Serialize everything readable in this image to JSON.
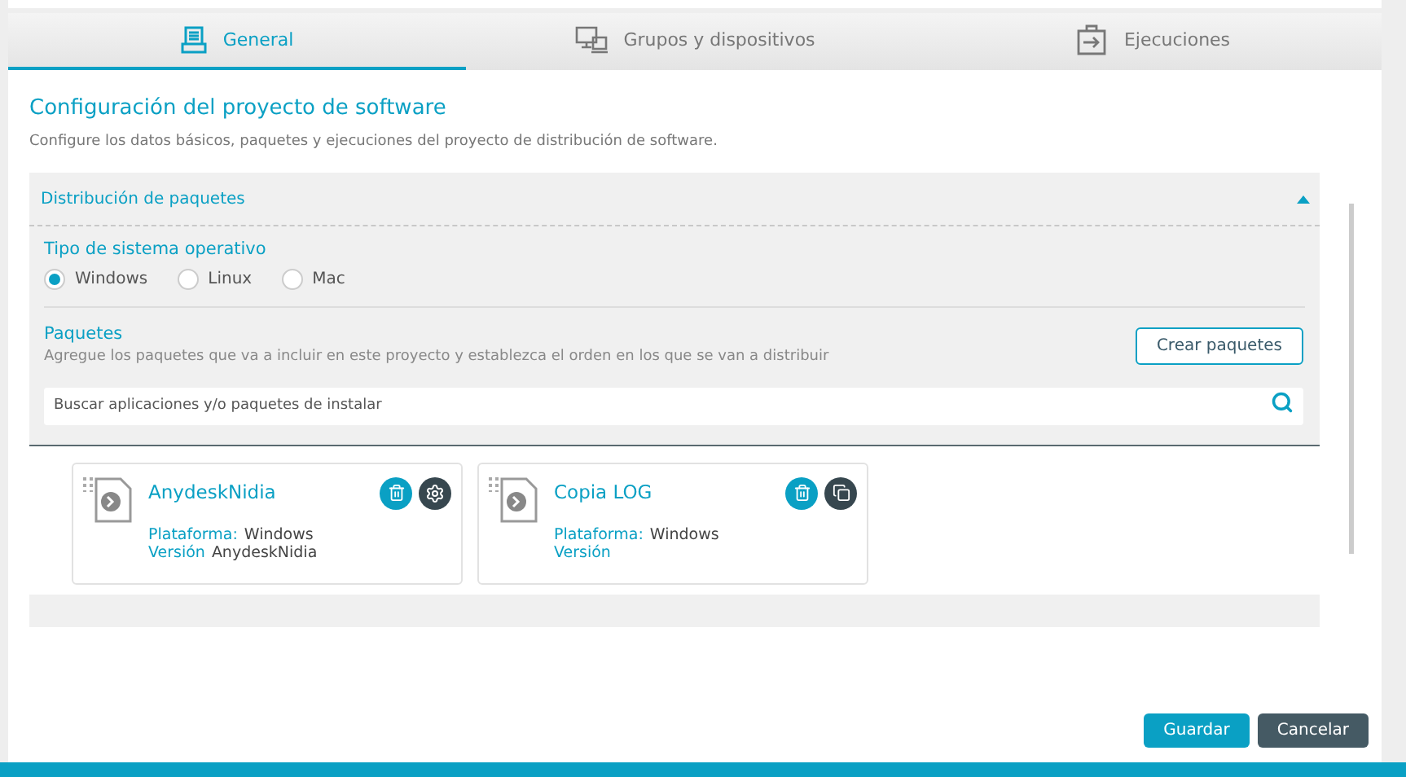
{
  "tabs": [
    {
      "label": "General",
      "selected": true
    },
    {
      "label": "Grupos y dispositivos",
      "selected": false
    },
    {
      "label": "Ejecuciones",
      "selected": false
    }
  ],
  "title": "Configuración del proyecto de software",
  "subtitle": "Configure los datos básicos, paquetes y ejecuciones del proyecto de distribución de software.",
  "section": {
    "title": "Distribución de paquetes",
    "expanded": true,
    "os_label": "Tipo de sistema operativo",
    "os_options": [
      {
        "label": "Windows",
        "selected": true
      },
      {
        "label": "Linux",
        "selected": false
      },
      {
        "label": "Mac",
        "selected": false
      }
    ],
    "packages_label": "Paquetes",
    "packages_hint": "Agregue los paquetes que va a incluir en este proyecto y establezca el orden en los que se van a distribuir",
    "create_button": "Crear paquetes",
    "search": {
      "placeholder": "Buscar aplicaciones y/o paquetes de instalar"
    },
    "packages": [
      {
        "name": "AnydeskNidia",
        "platform_label": "Plataforma:",
        "platform": "Windows",
        "version_label": "Versión",
        "version": "AnydeskNidia",
        "actions": [
          {
            "kind": "delete"
          },
          {
            "kind": "settings"
          }
        ]
      },
      {
        "name": "Copia LOG",
        "platform_label": "Plataforma:",
        "platform": "Windows",
        "version_label": "Versión",
        "actions": [
          {
            "kind": "delete"
          },
          {
            "kind": "copy"
          }
        ]
      }
    ]
  },
  "buttons": [
    {
      "label": "Guardar",
      "kind": "primary"
    },
    {
      "label": "Cancelar",
      "kind": "secondary"
    }
  ]
}
